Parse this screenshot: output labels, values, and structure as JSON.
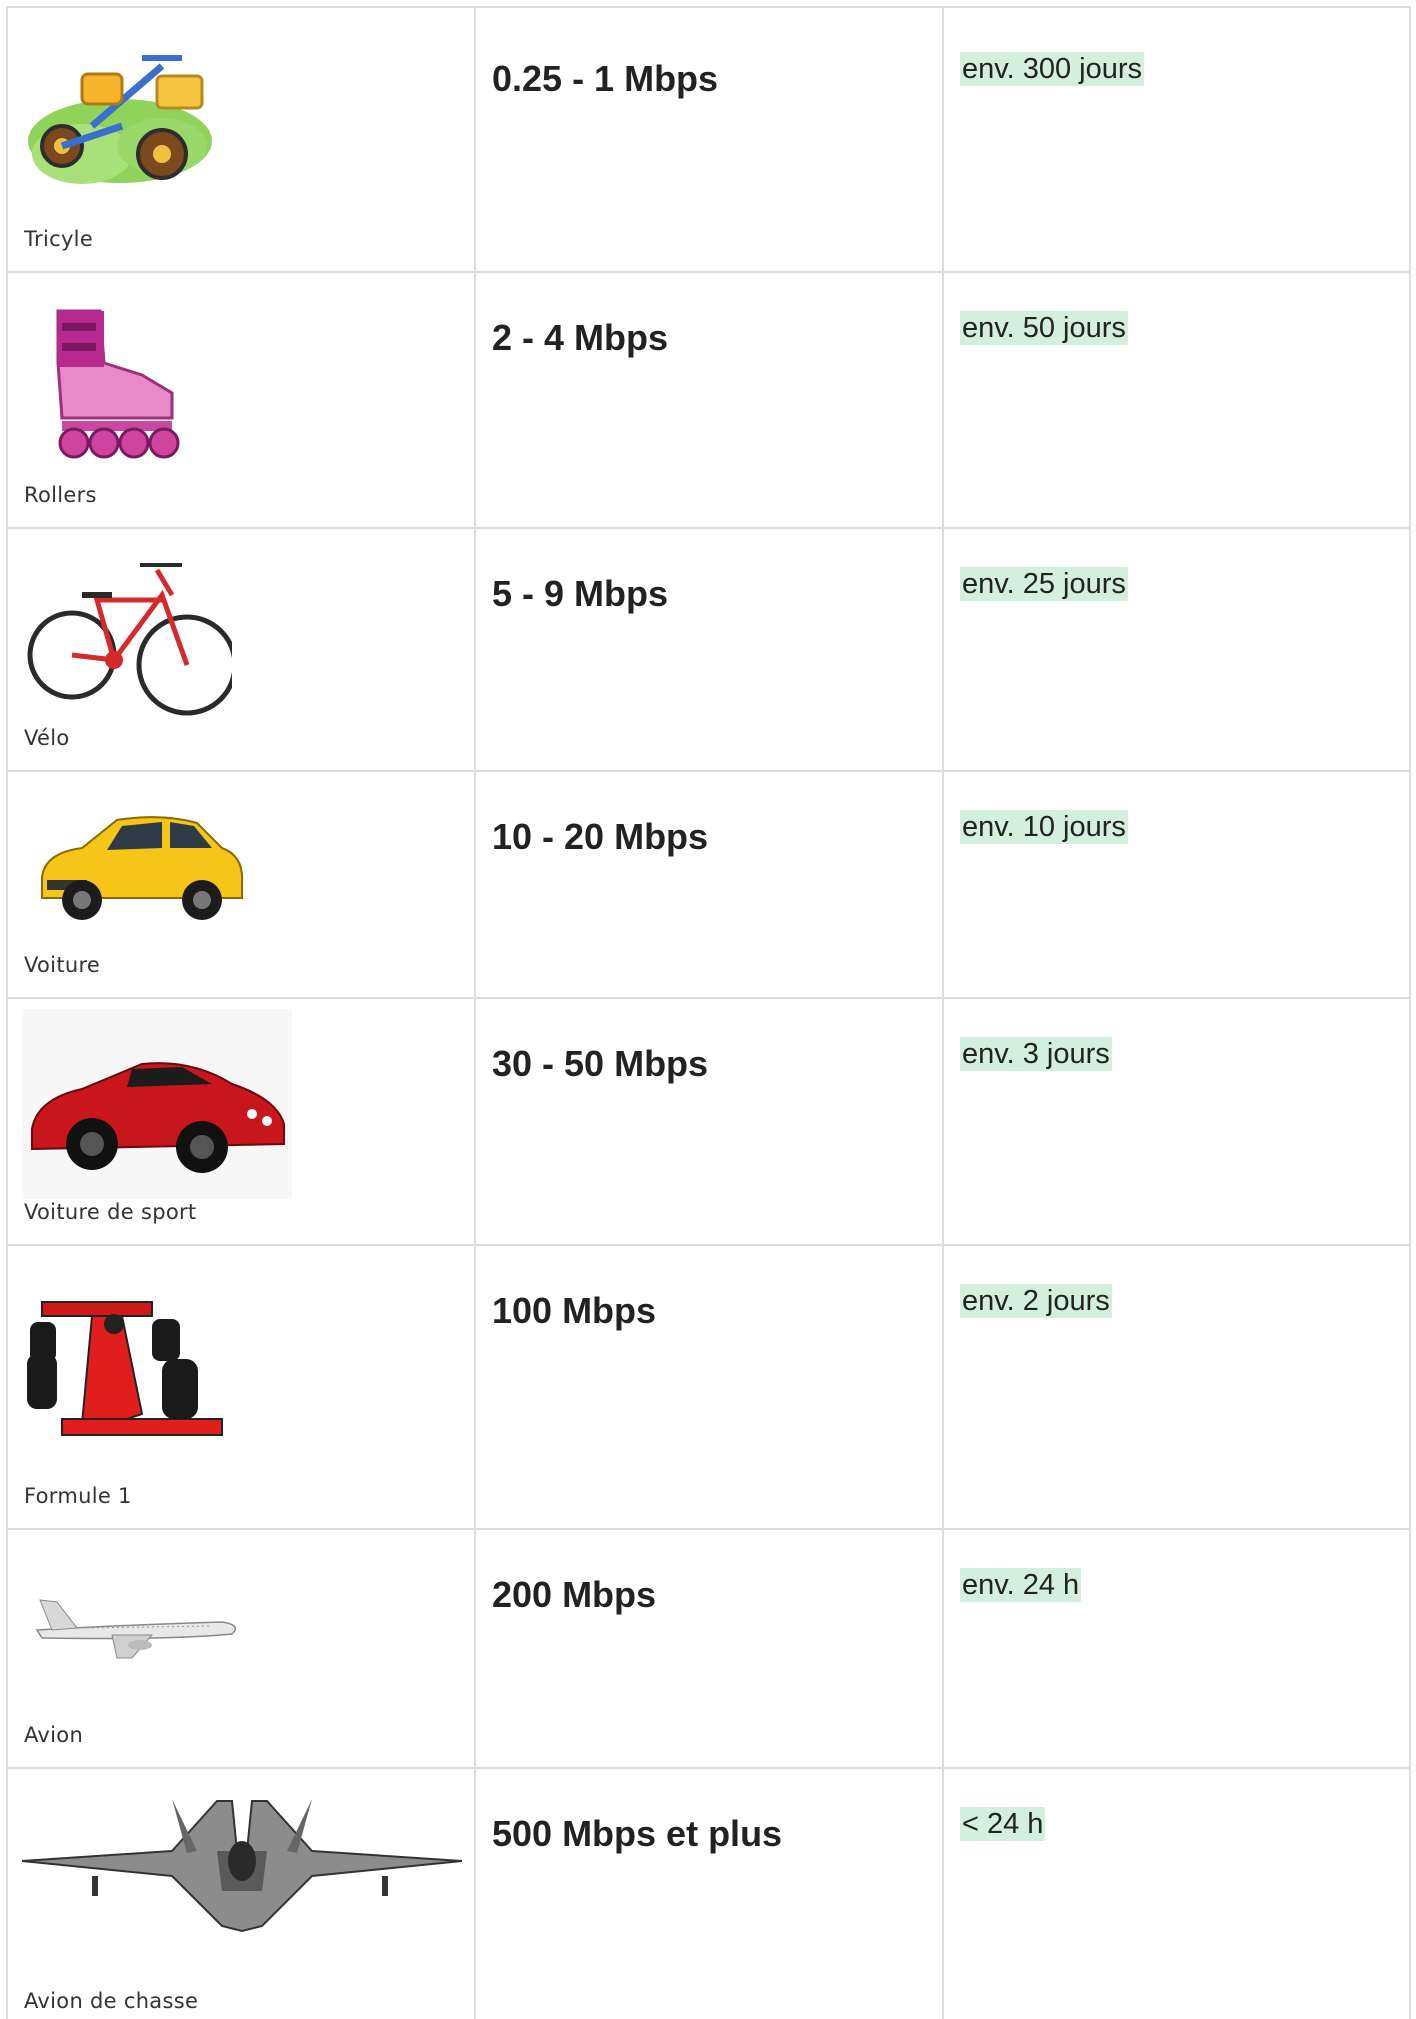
{
  "rows": [
    {
      "label": "Tricyle",
      "speed": "0.25 - 1 Mbps",
      "duration": "env. 300 jours",
      "icon": "tricycle-icon"
    },
    {
      "label": "Rollers",
      "speed": "2 - 4 Mbps",
      "duration": "env. 50 jours",
      "icon": "rollerskate-icon"
    },
    {
      "label": "Vélo",
      "speed": "5 - 9 Mbps",
      "duration": "env. 25 jours",
      "icon": "bicycle-icon"
    },
    {
      "label": "Voiture",
      "speed": "10 - 20 Mbps",
      "duration": "env. 10 jours",
      "icon": "car-icon"
    },
    {
      "label": "Voiture de sport",
      "speed": "30 - 50 Mbps",
      "duration": "env. 3 jours",
      "icon": "sportscar-icon"
    },
    {
      "label": "Formule 1",
      "speed": "100 Mbps",
      "duration": "env. 2 jours",
      "icon": "formula1-icon"
    },
    {
      "label": "Avion",
      "speed": "200 Mbps",
      "duration": "env. 24 h",
      "icon": "airplane-icon"
    },
    {
      "label": "Avion de chasse",
      "speed": "500 Mbps et plus",
      "duration": "< 24 h ",
      "icon": "fighterjet-icon"
    }
  ],
  "colors": {
    "highlight": "#d2f0dd",
    "border": "#dcdcdc",
    "text": "#222222"
  }
}
